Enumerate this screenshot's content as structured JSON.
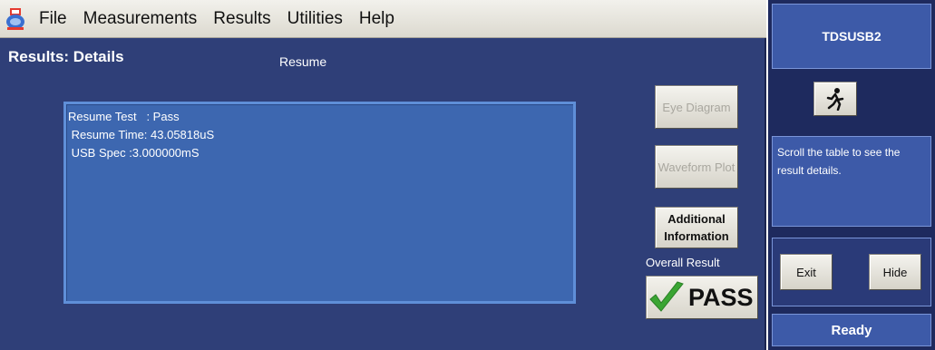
{
  "menubar": {
    "app_icon": "tekscope-app-icon",
    "items": [
      "File",
      "Measurements",
      "Results",
      "Utilities",
      "Help"
    ]
  },
  "results": {
    "page_title": "Results: Details",
    "section_title": "Resume",
    "details": [
      "Resume Test   : Pass",
      " Resume Time: 43.05818uS",
      " USB Spec :3.000000mS"
    ],
    "buttons": {
      "eye_diagram": "Eye Diagram",
      "waveform_plot": "Waveform Plot",
      "additional_information": "Additional Information"
    },
    "overall_result_label": "Overall Result",
    "overall_result": "PASS",
    "pass_color": "#3aa533"
  },
  "control_panel": {
    "app_name": "TDSUSB2",
    "run_icon": "running-man-icon",
    "help_text": "Scroll the table to see the result details.",
    "exit_label": "Exit",
    "hide_label": "Hide",
    "status": "Ready"
  },
  "colors": {
    "panel_bg": "#2f3f78",
    "details_bg": "#3d67b0",
    "control_panel_bg": "#1e2a5e"
  }
}
